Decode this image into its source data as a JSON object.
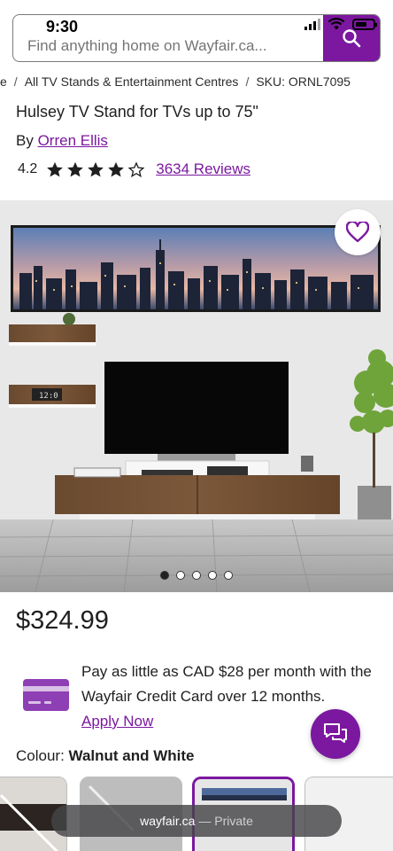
{
  "status_bar": {
    "time": "9:30"
  },
  "search": {
    "placeholder": "Find anything home on Wayfair.ca..."
  },
  "breadcrumb": {
    "items": [
      "e",
      "All TV Stands & Entertainment Centres",
      "SKU: ORNL7095"
    ],
    "separator": "/"
  },
  "product": {
    "title": "Hulsey TV Stand for TVs up to 75\"",
    "by_prefix": "By",
    "brand": "Orren Ellis",
    "rating": "4.2",
    "reviews": "3634 Reviews",
    "price": "$324.99",
    "colour_label": "Colour:",
    "colour_value": "Walnut and White"
  },
  "credit": {
    "text": "Pay as little as CAD $28 per month with the Wayfair Credit Card over 12 months.",
    "apply": "Apply Now"
  },
  "carousel": {
    "total": 5,
    "active": 1
  },
  "browser": {
    "domain": "wayfair.ca",
    "mode": "— Private"
  },
  "colors": {
    "brand": "#7b189f",
    "star": "#1f1f1f"
  },
  "icons": [
    "search-icon",
    "heart-icon",
    "chat-icon",
    "credit-card-icon",
    "star-icon"
  ]
}
